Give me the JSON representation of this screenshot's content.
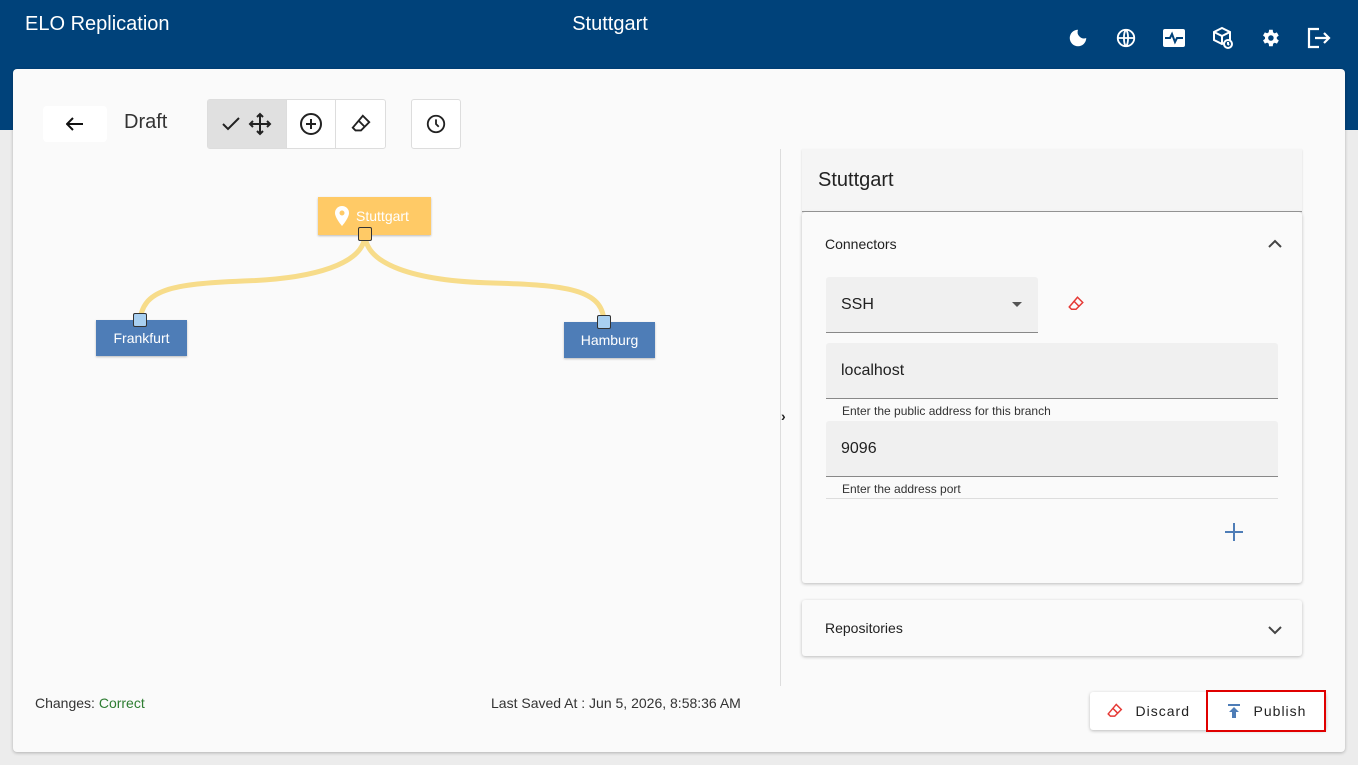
{
  "header": {
    "app_title": "ELO Replication",
    "branch_title": "Stuttgart",
    "icons": [
      "dark-mode-icon",
      "language-icon",
      "monitor-icon",
      "package-clock-icon",
      "settings-icon",
      "logout-icon"
    ]
  },
  "toolbar": {
    "draft_label": "Draft",
    "tools": [
      "select-move",
      "add-node",
      "erase"
    ],
    "history_icon": "clock-icon"
  },
  "graph": {
    "root": {
      "label": "Stuttgart",
      "color": "#ffca66"
    },
    "branches": [
      {
        "label": "Frankfurt",
        "color": "#4e7db7"
      },
      {
        "label": "Hamburg",
        "color": "#4e7db7"
      }
    ],
    "link_color": "#f7dc8a"
  },
  "panel": {
    "title": "Stuttgart",
    "connectors": {
      "title": "Connectors",
      "type_value": "SSH",
      "address_value": "localhost",
      "address_hint": "Enter the public address for this branch",
      "port_value": "9096",
      "port_hint": "Enter the address port"
    },
    "repositories": {
      "title": "Repositories"
    }
  },
  "footer": {
    "changes_label": "Changes:",
    "changes_value": "Correct",
    "last_saved": "Last Saved At : Jun 5, 2026, 8:58:36 AM",
    "discard_label": "Discard",
    "publish_label": "Publish"
  },
  "colors": {
    "header_bg": "#00427a",
    "accent_blue": "#4e7db7",
    "status_ok": "#2e7d32",
    "highlight_border": "#e00000"
  }
}
